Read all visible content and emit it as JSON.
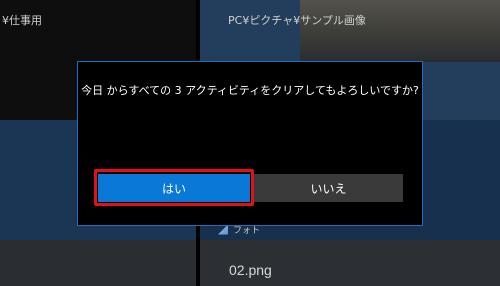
{
  "background": {
    "left_caption": "¥仕事用",
    "right_caption": "PC¥ピクチャ¥サンプル画像",
    "photo_tag_label": "フォト",
    "file_name": "02.png"
  },
  "dialog": {
    "message": "今日 からすべての 3 アクティビティをクリアしてもよろしいですか?",
    "yes_label": "はい",
    "no_label": "いいえ"
  },
  "colors": {
    "primary_button": "#0a78d7",
    "secondary_button": "#3a3a3a",
    "dialog_border": "#1f6dbe",
    "highlight": "#e3101b"
  }
}
